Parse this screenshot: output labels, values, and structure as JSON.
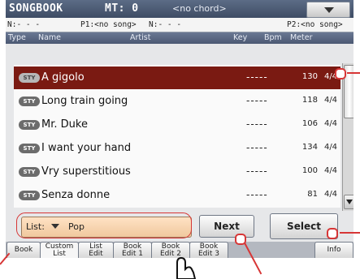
{
  "title": "SONGBOOK",
  "mt_label": "MT: 0",
  "chord": "<no chord>",
  "info": {
    "n1": "N:- - -",
    "p1": "P1:<no song>",
    "n2": "N:- - -",
    "p2": "P2:<no song>"
  },
  "columns": {
    "type": "Type",
    "name": "Name",
    "artist": "Artist",
    "key": "Key",
    "bpm": "Bpm",
    "meter": "Meter"
  },
  "rows": [
    {
      "type": "STY",
      "name": "A gigolo",
      "key": "-----",
      "bpm": "130",
      "meter": "4/4",
      "selected": true
    },
    {
      "type": "STY",
      "name": "Long train going",
      "key": "-----",
      "bpm": "118",
      "meter": "4/4",
      "selected": false
    },
    {
      "type": "STY",
      "name": "Mr. Duke",
      "key": "-----",
      "bpm": "106",
      "meter": "4/4",
      "selected": false
    },
    {
      "type": "STY",
      "name": "I want your hand",
      "key": "-----",
      "bpm": "134",
      "meter": "4/4",
      "selected": false
    },
    {
      "type": "STY",
      "name": "Vry superstitious",
      "key": "-----",
      "bpm": "100",
      "meter": "4/4",
      "selected": false
    },
    {
      "type": "STY",
      "name": "Senza donne",
      "key": "-----",
      "bpm": "81",
      "meter": "4/4",
      "selected": false
    }
  ],
  "list": {
    "label": "List:",
    "value": "Pop"
  },
  "buttons": {
    "next": "Next",
    "select": "Select"
  },
  "tabs": [
    {
      "line1": "Book",
      "line2": "",
      "active": false
    },
    {
      "line1": "Custom",
      "line2": "List",
      "active": true
    },
    {
      "line1": "List",
      "line2": "Edit",
      "active": false
    },
    {
      "line1": "Book",
      "line2": "Edit 1",
      "active": false
    },
    {
      "line1": "Book",
      "line2": "Edit 2",
      "active": false
    },
    {
      "line1": "Book",
      "line2": "Edit 3",
      "active": false
    },
    {
      "line1": "Info",
      "line2": "",
      "active": false
    }
  ],
  "colors": {
    "selected_row": "#7a1a12",
    "callout": "#d73636",
    "list_field": "#f0c89e"
  }
}
